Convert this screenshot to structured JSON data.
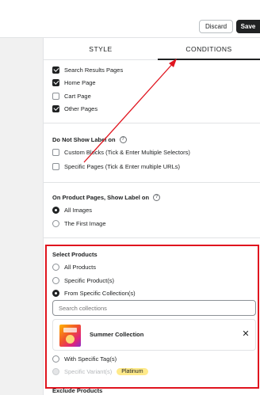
{
  "header": {
    "discard_label": "Discard",
    "save_label": "Save"
  },
  "tabs": [
    {
      "label": "STYLE"
    },
    {
      "label": "CONDITIONS"
    }
  ],
  "show_on_pages": {
    "items": [
      {
        "label": "Search Results Pages",
        "checked": true
      },
      {
        "label": "Home Page",
        "checked": true
      },
      {
        "label": "Cart Page",
        "checked": false
      },
      {
        "label": "Other Pages",
        "checked": true
      }
    ]
  },
  "do_not_show": {
    "title": "Do Not Show Label on",
    "help_icon": "question-circle-icon",
    "items": [
      {
        "label": "Custom Blocks (Tick & Enter Multiple Selectors)",
        "checked": false
      },
      {
        "label": "Specific Pages (Tick & Enter multiple URLs)",
        "checked": false
      }
    ]
  },
  "product_pages": {
    "title": "On Product Pages, Show Label on",
    "help_icon": "question-circle-icon",
    "options": [
      {
        "label": "All Images",
        "selected": true
      },
      {
        "label": "The First Image",
        "selected": false
      }
    ]
  },
  "select_products": {
    "title": "Select Products",
    "options": [
      {
        "label": "All Products",
        "selected": false
      },
      {
        "label": "Specific Product(s)",
        "selected": false
      },
      {
        "label": "From Specific Collection(s)",
        "selected": true
      }
    ],
    "search": {
      "placeholder": "Search collections"
    },
    "collection": {
      "name": "Summer Collection",
      "thumb_icon": "summer-collection-image"
    },
    "more_options": [
      {
        "label": "With Specific Tag(s)",
        "selected": false
      },
      {
        "label": "Specific Variant(s)",
        "selected": false,
        "disabled": true,
        "badge": "Platinum"
      }
    ]
  },
  "exclude_products": {
    "title": "Exclude Products"
  },
  "colors": {
    "highlight": "#e0141e",
    "accent_dark": "#202223",
    "badge_bg": "#ffea8a"
  }
}
